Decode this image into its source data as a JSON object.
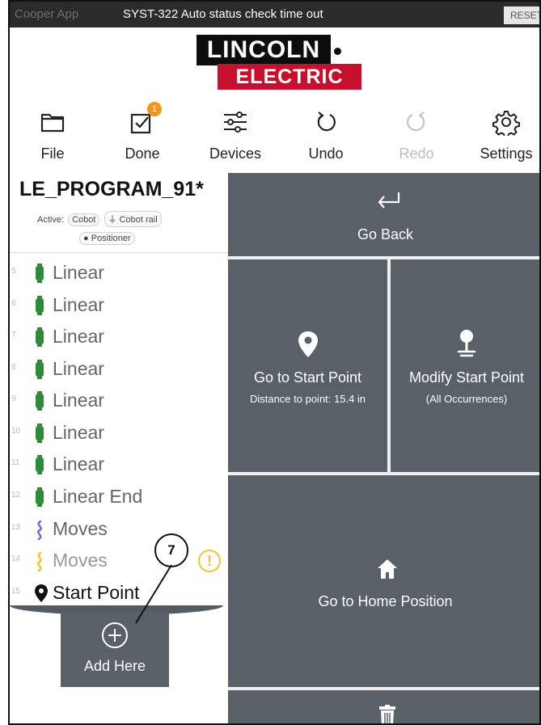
{
  "titlebar": {
    "app_name": "Cooper App",
    "message": "SYST-322  Auto status check time out",
    "reset_label": "RESET"
  },
  "logo": {
    "line1": "LINCOLN",
    "line2": "ELECTRIC"
  },
  "toolbar": {
    "items": [
      {
        "label": "File",
        "icon": "folder-icon"
      },
      {
        "label": "Done",
        "icon": "checkbox-icon",
        "badge": "1"
      },
      {
        "label": "Devices",
        "icon": "sliders-icon"
      },
      {
        "label": "Undo",
        "icon": "undo-icon"
      },
      {
        "label": "Redo",
        "icon": "redo-icon",
        "disabled": true
      },
      {
        "label": "Settings",
        "icon": "gear-icon"
      }
    ]
  },
  "program": {
    "title": "LE_PROGRAM_91*",
    "active_label": "Active:",
    "devices": [
      "Cobot",
      "Cobot rail",
      "Positioner"
    ]
  },
  "steps": [
    {
      "num": "5",
      "label": "Linear",
      "icon": "linear-weld-icon"
    },
    {
      "num": "6",
      "label": "Linear",
      "icon": "linear-weld-icon"
    },
    {
      "num": "7",
      "label": "Linear",
      "icon": "linear-weld-icon"
    },
    {
      "num": "8",
      "label": "Linear",
      "icon": "linear-weld-icon"
    },
    {
      "num": "9",
      "label": "Linear",
      "icon": "linear-weld-icon"
    },
    {
      "num": "10",
      "label": "Linear",
      "icon": "linear-weld-icon"
    },
    {
      "num": "11",
      "label": "Linear",
      "icon": "linear-weld-icon"
    },
    {
      "num": "12",
      "label": "Linear End",
      "icon": "linear-weld-icon"
    },
    {
      "num": "13",
      "label": "Moves",
      "icon": "moves-icon"
    },
    {
      "num": "14",
      "label": "Moves",
      "icon": "moves-icon"
    },
    {
      "num": "15",
      "label": "Start Point",
      "icon": "location-pin-icon"
    }
  ],
  "callout_number": "7",
  "warning_symbol": "!",
  "add_here": {
    "label": "Add Here"
  },
  "actions": {
    "go_back": "Go Back",
    "go_to_start": {
      "title": "Go to Start Point",
      "sub": "Distance to point: 15.4 in"
    },
    "modify_start": {
      "title": "Modify Start Point",
      "sub": "(All Occurrences)"
    },
    "go_home": "Go to Home Position"
  },
  "colors": {
    "tile": "#5a6068",
    "weld_green": "#2e8b3a",
    "moves_blue": "#6a6fd6",
    "moves_yellow": "#f4c430",
    "badge_orange": "#f7941d",
    "brand_red": "#c8102e"
  }
}
